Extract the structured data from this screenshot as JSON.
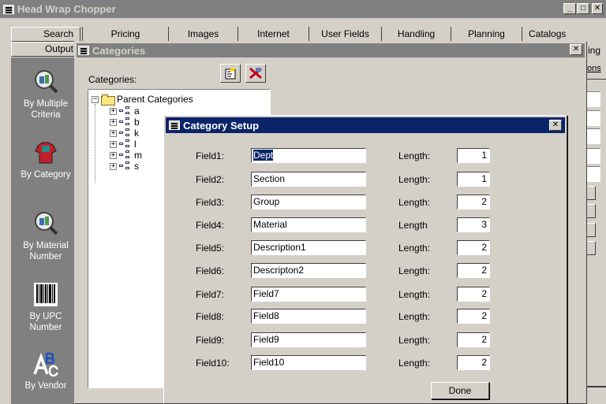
{
  "app": {
    "title": "Head Wrap Chopper",
    "window_buttons": {
      "minimize": "_",
      "maximize": "□",
      "close": "✕"
    }
  },
  "toolbar": {
    "search_label": "Search",
    "output_label": "Output"
  },
  "tabs": [
    "Pricing",
    "Images",
    "Internet",
    "User Fields",
    "Handling",
    "Planning",
    "Catalogs"
  ],
  "right_edge": {
    "tab_fragment": "ing",
    "link_fragment": "ons"
  },
  "leftbar": {
    "items": [
      {
        "label_line1": "By Multiple",
        "label_line2": "Criteria",
        "icon": "magnifier-icon"
      },
      {
        "label_line1": "By Category",
        "label_line2": "",
        "icon": "shirt-icon"
      },
      {
        "label_line1": "By Material",
        "label_line2": "Number",
        "icon": "magnifier-icon"
      },
      {
        "label_line1": "By UPC",
        "label_line2": "Number",
        "icon": "barcode-icon"
      },
      {
        "label_line1": "By Vendor",
        "label_line2": "",
        "icon": "abc-icon"
      }
    ]
  },
  "categories_window": {
    "title": "Categories",
    "close": "✕",
    "label": "Categories:",
    "tree": {
      "root": "Parent Categories",
      "children": [
        "a",
        "b",
        "k",
        "l",
        "m",
        "s"
      ]
    }
  },
  "setup": {
    "title": "Category Setup",
    "close": "✕",
    "rows": [
      {
        "label": "Field1:",
        "value": "Dept",
        "length_label": "Length:",
        "length": "1"
      },
      {
        "label": "Field2:",
        "value": "Section",
        "length_label": "Length:",
        "length": "1"
      },
      {
        "label": "Field3:",
        "value": "Group",
        "length_label": "Length:",
        "length": "2"
      },
      {
        "label": "Field4:",
        "value": "Material",
        "length_label": "Length",
        "length": "3"
      },
      {
        "label": "Field5:",
        "value": "Description1",
        "length_label": "Length:",
        "length": "2"
      },
      {
        "label": "Field6:",
        "value": "Descripton2",
        "length_label": "Length:",
        "length": "2"
      },
      {
        "label": "Field7:",
        "value": "Field7",
        "length_label": "Length:",
        "length": "2"
      },
      {
        "label": "Field8:",
        "value": "Field8",
        "length_label": "Length:",
        "length": "2"
      },
      {
        "label": "Field9:",
        "value": "Field9",
        "length_label": "Length:",
        "length": "2"
      },
      {
        "label": "Field10:",
        "value": "Field10",
        "length_label": "Length:",
        "length": "2"
      }
    ],
    "done_label": "Done"
  },
  "colors": {
    "active_title": "#0a246a",
    "inactive_title": "#808080",
    "face": "#d4d0c8"
  }
}
